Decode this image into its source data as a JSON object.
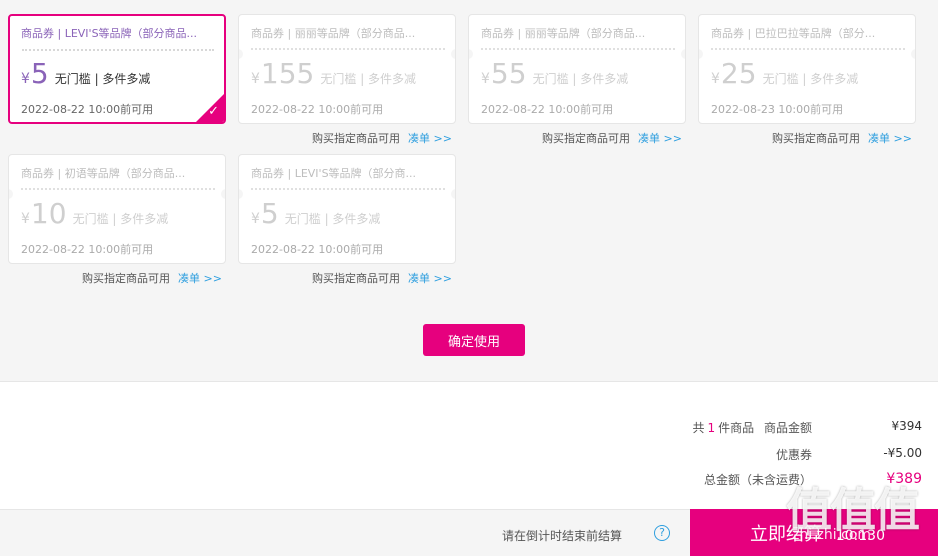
{
  "coupons": [
    {
      "title": "商品券 | LEVI'S等品牌（部分商品...",
      "yen": "¥",
      "amount": "5",
      "desc": "无门槛 | 多件多减",
      "date": "2022-08-22 10:00前可用",
      "selected": true
    },
    {
      "title": "商品券 | 丽丽等品牌（部分商品...",
      "yen": "¥",
      "amount": "155",
      "desc": "无门槛 | 多件多减",
      "date": "2022-08-22 10:00前可用",
      "link": "购买指定商品可用",
      "cou": "凑单 >>"
    },
    {
      "title": "商品券 | 丽丽等品牌（部分商品...",
      "yen": "¥",
      "amount": "55",
      "desc": "无门槛 | 多件多减",
      "date": "2022-08-22 10:00前可用",
      "link": "购买指定商品可用",
      "cou": "凑单 >>"
    },
    {
      "title": "商品券 | 巴拉巴拉等品牌（部分...",
      "yen": "¥",
      "amount": "25",
      "desc": "无门槛 | 多件多减",
      "date": "2022-08-23 10:00前可用",
      "link": "购买指定商品可用",
      "cou": "凑单 >>"
    },
    {
      "title": "商品券 | 初语等品牌（部分商品...",
      "yen": "¥",
      "amount": "10",
      "desc": "无门槛 | 多件多减",
      "date": "2022-08-22 10:00前可用",
      "link": "购买指定商品可用",
      "cou": "凑单 >>"
    },
    {
      "title": "商品券 | LEVI'S等品牌（部分商...",
      "yen": "¥",
      "amount": "5",
      "desc": "无门槛 | 多件多减",
      "date": "2022-08-22 10:00前可用",
      "link": "购买指定商品可用",
      "cou": "凑单 >>"
    }
  ],
  "confirm_label": "确定使用",
  "summary": {
    "prefix": "共",
    "count": "1",
    "suffix": "件商品",
    "goods_label": "商品金额",
    "goods_value": "¥394",
    "coupon_label": "优惠券",
    "coupon_value": "-¥5.00",
    "total_label": "总金额（未含运费）",
    "total_value": "¥389"
  },
  "bottom": {
    "tip": "请在倒计时结束前结算",
    "help": "?",
    "checkout_label": "立即结算",
    "checkout_timer": "10:130"
  },
  "watermark": {
    "logo": "值值值",
    "site": "zhi.zhi.com"
  },
  "colors": {
    "accent": "#e6007e",
    "purple": "#8a63b8",
    "link": "#2f9fdf"
  }
}
